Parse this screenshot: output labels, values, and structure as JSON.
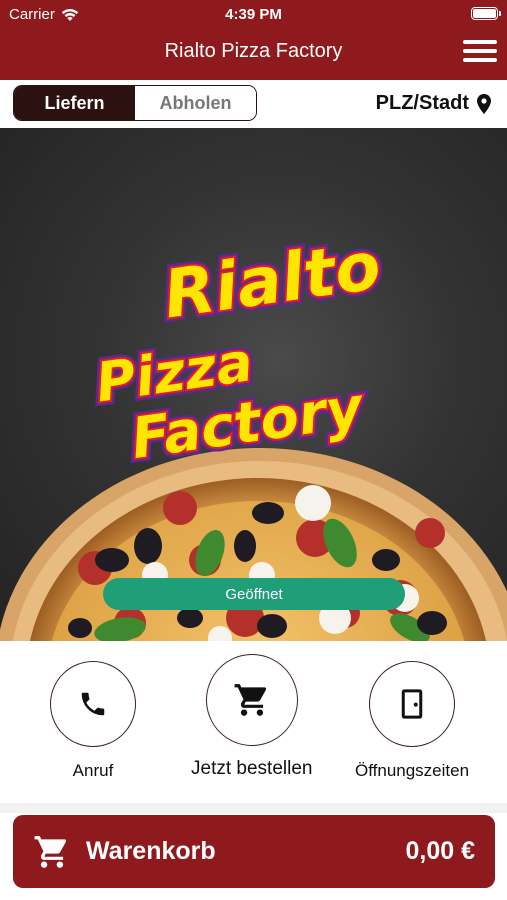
{
  "status_bar": {
    "carrier": "Carrier",
    "time": "4:39 PM"
  },
  "nav": {
    "title": "Rialto Pizza Factory",
    "menu_icon": "hamburger-menu-icon"
  },
  "delivery_toggle": {
    "options": [
      "Liefern",
      "Abholen"
    ],
    "selected": "Liefern"
  },
  "location": {
    "label": "PLZ/Stadt",
    "icon": "map-pin-icon"
  },
  "hero": {
    "logo_line1": "Rialto",
    "logo_line2": "Pizza",
    "logo_line3": "Factory",
    "open_status": "Geöffnet"
  },
  "actions": [
    {
      "label": "Anruf",
      "icon": "phone-icon"
    },
    {
      "label": "Jetzt bestellen",
      "icon": "cart-icon"
    },
    {
      "label": "Öffnungszeiten",
      "icon": "door-icon"
    }
  ],
  "cart": {
    "label": "Warenkorb",
    "total": "0,00 €",
    "icon": "cart-icon"
  },
  "colors": {
    "brand": "#8e1a1d",
    "segment_dark": "#2b1210",
    "open_green": "#1f9e78",
    "logo_yellow": "#ffe600",
    "logo_red": "#e01e25",
    "logo_purple": "#5b2a8c"
  }
}
